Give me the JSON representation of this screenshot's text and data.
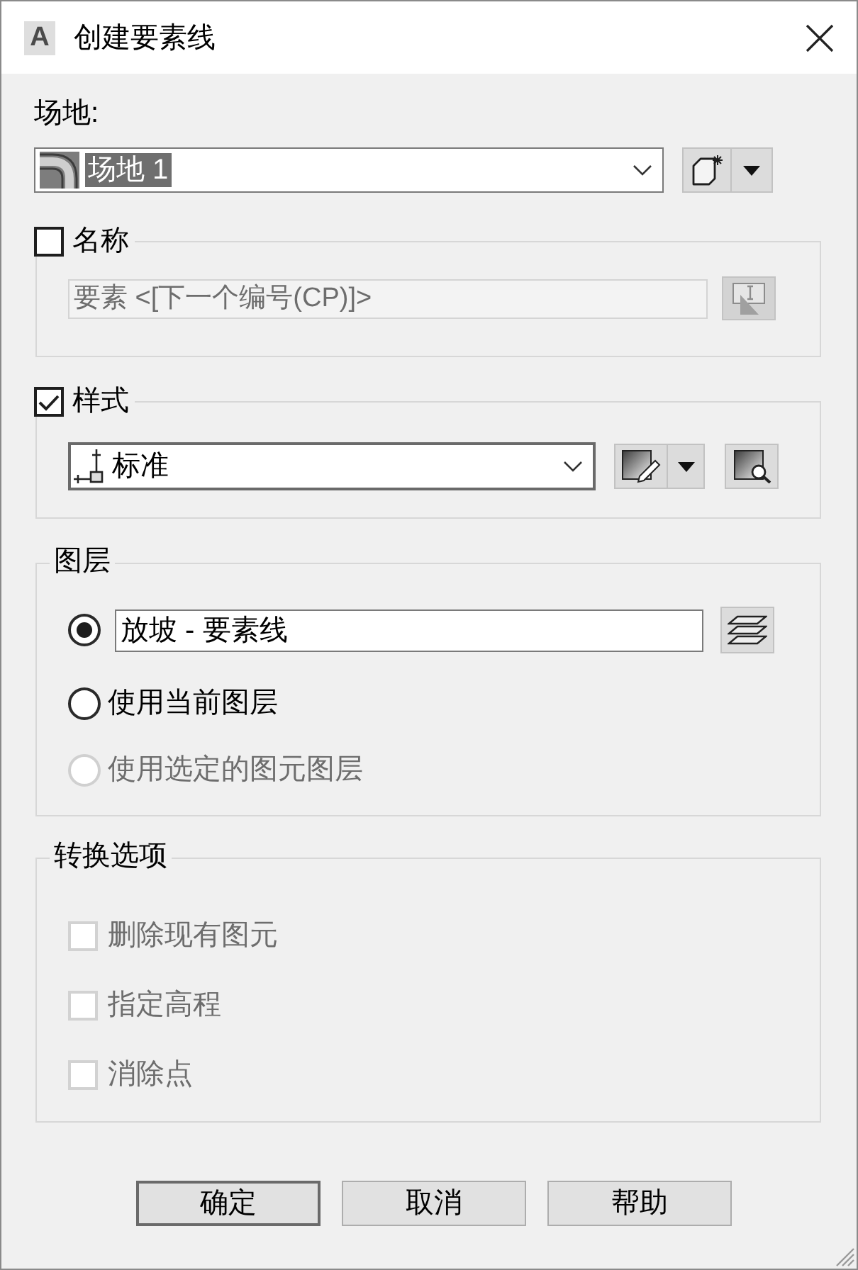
{
  "window": {
    "logo": "A",
    "title": "创建要素线"
  },
  "site": {
    "label": "场地:",
    "value": "场地 1",
    "highlighted": true
  },
  "name_group": {
    "label": "名称",
    "checked": false,
    "field": {
      "value": "要素 <[下一个编号(CP)]>",
      "disabled": true
    }
  },
  "style_group": {
    "label": "样式",
    "checked": true,
    "dropdown": {
      "value": "标准"
    }
  },
  "layer_group": {
    "label": "图层",
    "options": [
      {
        "kind": "field",
        "value": "放坡 - 要素线",
        "selected": true,
        "disabled": false
      },
      {
        "kind": "text",
        "label": "使用当前图层",
        "selected": false,
        "disabled": false
      },
      {
        "kind": "text",
        "label": "使用选定的图元图层",
        "selected": false,
        "disabled": true
      }
    ]
  },
  "conversion_group": {
    "label": "转换选项",
    "options": [
      {
        "label": "删除现有图元",
        "checked": false,
        "disabled": true
      },
      {
        "label": "指定高程",
        "checked": false,
        "disabled": true
      },
      {
        "label": "消除点",
        "checked": false,
        "disabled": true
      }
    ]
  },
  "buttons": [
    {
      "label": "确定",
      "default": true
    },
    {
      "label": "取消",
      "default": false
    },
    {
      "label": "帮助",
      "default": false
    }
  ]
}
